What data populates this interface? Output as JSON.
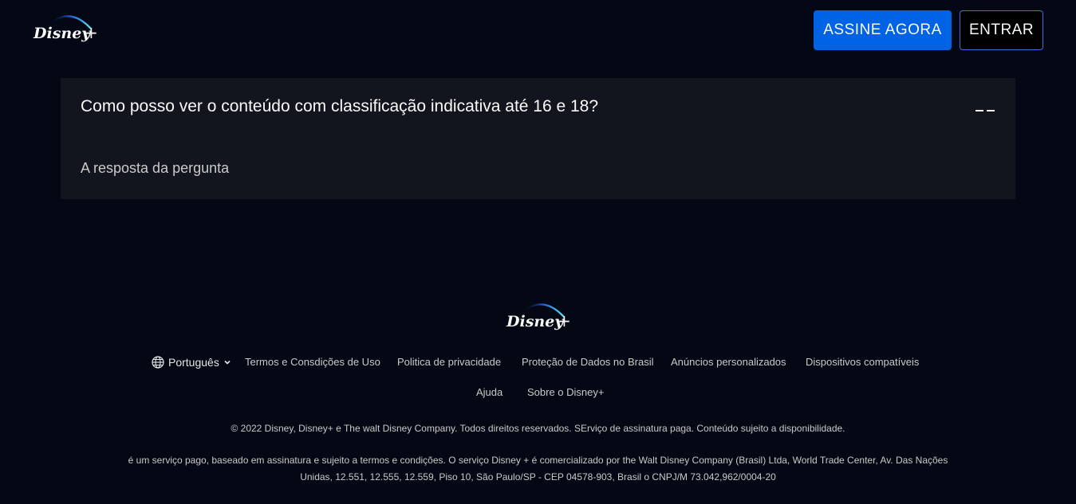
{
  "header": {
    "logo_alt": "Disney+",
    "subscribe_label": "ASSINE AGORA",
    "login_label": "ENTRAR"
  },
  "faq": {
    "question": "Como posso ver o conteúdo com classificação indicativa até 16 e 18?",
    "answer": "A resposta da pergunta",
    "expanded": true
  },
  "footer": {
    "language": "Português",
    "links": [
      "Termos e Consdições de Uso",
      "Politica de privacidade",
      "Proteção de Dados no Brasil",
      "Anúncios personalizados",
      "Dispositivos compatíveis"
    ],
    "links2": [
      "Ajuda",
      "Sobre o Disney+"
    ],
    "copyright": "© 2022 Disney, Disney+ e The walt Disney Company. Todos direitos reservados. SErviço de assinatura paga. Conteúdo sujeito a disponibilidade.",
    "legal": "é um serviço pago, baseado em assinatura e sujeito a termos e condições. O serviço Disney + é comercializado por the Walt Disney Company (Brasil) Ltda, World Trade Center, Av. Das Nações Unidas, 12.551, 12.555, 12.559, Piso 10, São Paulo/SP - CEP 04578-903, Brasil o CNPJ/M 73.042,962/0004-20"
  },
  "colors": {
    "background": "#040714",
    "accent": "#0063e5",
    "panel": "#13151e"
  }
}
